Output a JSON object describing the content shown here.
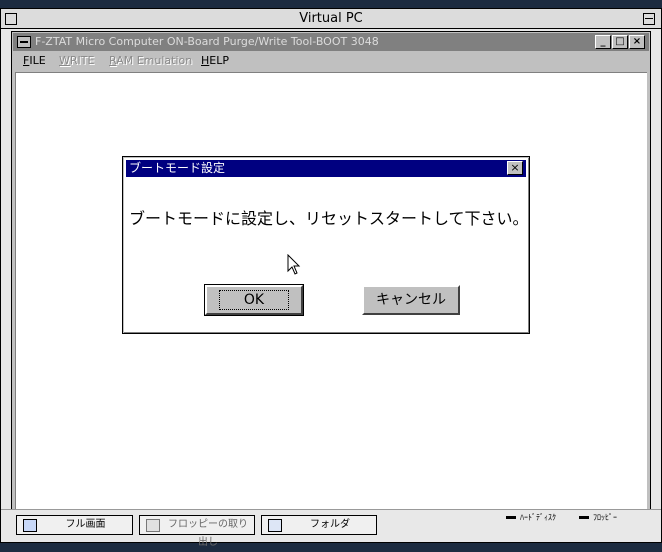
{
  "mac_window": {
    "title": "Virtual PC"
  },
  "app_window": {
    "title": "F-ZTAT Micro Computer ON-Board Purge/Write Tool-BOOT 3048",
    "buttons": {
      "minimize": "_",
      "maximize": "□",
      "close": "×"
    },
    "menu": [
      {
        "mnemonic": "F",
        "rest": "ILE",
        "enabled": true
      },
      {
        "mnemonic": "W",
        "rest": "RITE",
        "enabled": false
      },
      {
        "mnemonic": "R",
        "rest": "AM Emulation",
        "enabled": false
      },
      {
        "mnemonic": "H",
        "rest": "ELP",
        "enabled": true
      }
    ]
  },
  "dialog": {
    "title": "ブートモード設定",
    "message": "ブートモードに設定し、リセットスタートして下さい。",
    "close_glyph": "×",
    "ok_label": "OK",
    "cancel_label": "キャンセル"
  },
  "statusbar": {
    "fullscreen_label": "フル画面",
    "floppy_eject_label": "フロッピーの取り出し",
    "folder_label": "フォルダ",
    "hard_disk_label": "ﾊｰﾄﾞﾃﾞｨｽｸ",
    "floppy_label": "ﾌﾛｯﾋﾟｰ"
  },
  "colors": {
    "dialog_title_bg": "#000080",
    "inactive_title_bg": "#808080",
    "button_face": "#c0c0c0"
  }
}
